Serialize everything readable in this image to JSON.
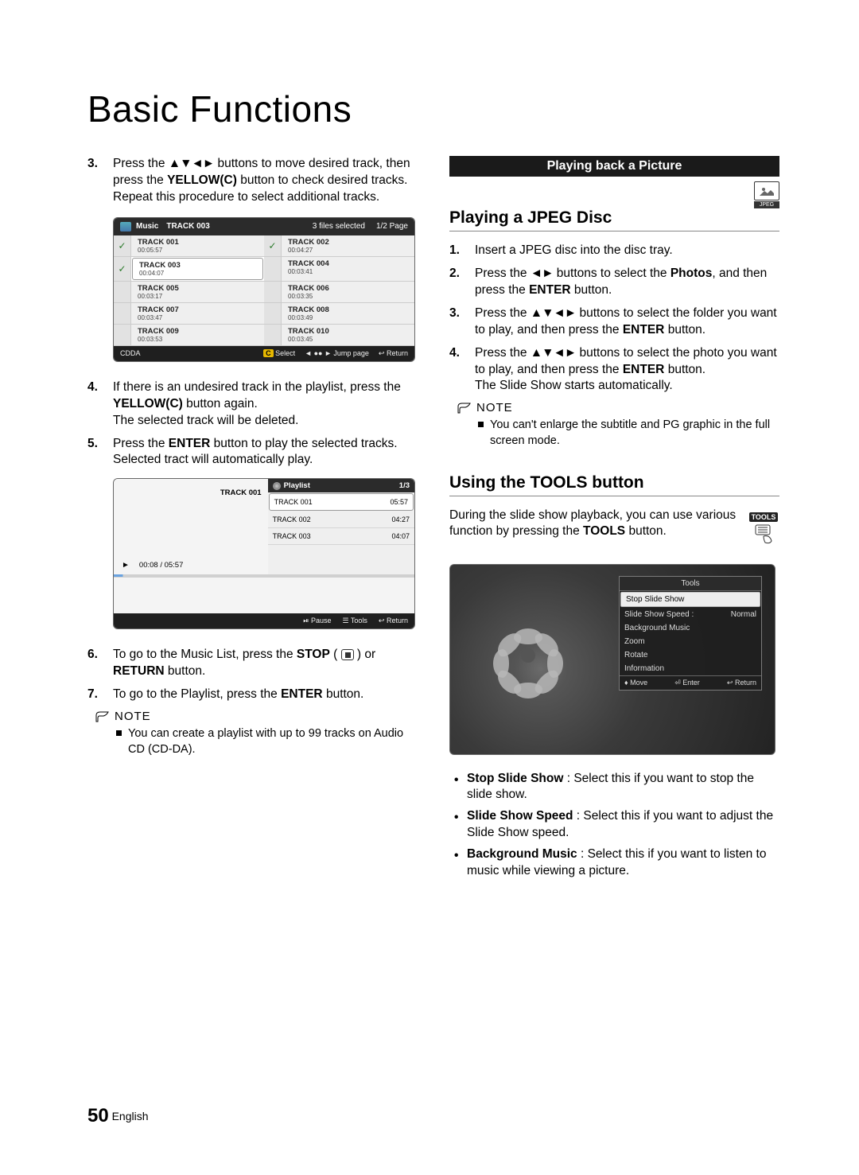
{
  "page_title": "Basic Functions",
  "footer": {
    "page": "50",
    "lang": "English"
  },
  "left": {
    "step3": {
      "num": "3.",
      "text_a": "Press the ",
      "arrows": "▲▼◄►",
      "text_b": " buttons to move desired track, then press the ",
      "yellow": "YELLOW(C)",
      "text_c": " button to check desired tracks.",
      "repeat": "Repeat this procedure to select additional tracks."
    },
    "music_panel": {
      "header_label": "Music",
      "current_track": "TRACK 003",
      "files_selected": "3 files selected",
      "page_indicator": "1/2 Page",
      "tracks": [
        {
          "name": "TRACK 001",
          "dur": "00:05:57",
          "checked": true,
          "sel": false
        },
        {
          "name": "TRACK 002",
          "dur": "00:04:27",
          "checked": true,
          "sel": false
        },
        {
          "name": "TRACK 003",
          "dur": "00:04:07",
          "checked": true,
          "sel": true
        },
        {
          "name": "TRACK 004",
          "dur": "00:03:41",
          "checked": false,
          "sel": false
        },
        {
          "name": "TRACK 005",
          "dur": "00:03:17",
          "checked": false,
          "sel": false
        },
        {
          "name": "TRACK 006",
          "dur": "00:03:35",
          "checked": false,
          "sel": false
        },
        {
          "name": "TRACK 007",
          "dur": "00:03:47",
          "checked": false,
          "sel": false
        },
        {
          "name": "TRACK 008",
          "dur": "00:03:49",
          "checked": false,
          "sel": false
        },
        {
          "name": "TRACK 009",
          "dur": "00:03:53",
          "checked": false,
          "sel": false
        },
        {
          "name": "TRACK 010",
          "dur": "00:03:45",
          "checked": false,
          "sel": false
        }
      ],
      "footer": {
        "left": "CDDA",
        "select_key": "C",
        "select_label": "Select",
        "jump_icon": "◄ ●● ►",
        "jump_label": "Jump page",
        "return_icon": "↩",
        "return_label": "Return"
      }
    },
    "step4": {
      "num": "4.",
      "text_a": "If there is an undesired track in the playlist, press the ",
      "yellow": "YELLOW(C)",
      "text_b": " button again.",
      "after": "The selected track will be deleted."
    },
    "step5": {
      "num": "5.",
      "text_a": "Press the ",
      "enter": "ENTER",
      "text_b": " button to play the selected tracks.",
      "after": "Selected tract will automatically play."
    },
    "playlist_panel": {
      "now_playing": "TRACK 001",
      "elapsed": "00:08 / 05:57",
      "header": "Playlist",
      "page": "1/3",
      "rows": [
        {
          "name": "TRACK 001",
          "dur": "05:57",
          "sel": true
        },
        {
          "name": "TRACK 002",
          "dur": "04:27",
          "sel": false
        },
        {
          "name": "TRACK 003",
          "dur": "04:07",
          "sel": false
        }
      ],
      "footer": {
        "pause_icon": "⏯",
        "pause": "Pause",
        "tools_icon": "☰",
        "tools": "Tools",
        "return_icon": "↩",
        "return": "Return"
      }
    },
    "step6": {
      "num": "6.",
      "text_a": "To go to the Music List, press the ",
      "stop": "STOP",
      "text_b": " ( ",
      "text_c": " ) or ",
      "return": "RETURN",
      "text_d": " button."
    },
    "step7": {
      "num": "7.",
      "text_a": "To go to the Playlist, press the ",
      "enter": "ENTER",
      "text_b": " button."
    },
    "note_label": "NOTE",
    "note1": "You can create a playlist with up to 99 tracks on Audio CD (CD-DA)."
  },
  "right": {
    "section_bar": "Playing back a Picture",
    "jpeg_badge": "JPEG",
    "h_jpeg": "Playing a JPEG Disc",
    "r1": {
      "num": "1.",
      "text": "Insert a JPEG disc into the disc tray."
    },
    "r2": {
      "num": "2.",
      "a": "Press the ",
      "arr": "◄►",
      "b": " buttons to select the ",
      "photos": "Photos",
      "c": ", and then press the ",
      "enter": "ENTER",
      "d": " button."
    },
    "r3": {
      "num": "3.",
      "a": "Press the ",
      "arr": "▲▼◄►",
      "b": " buttons to select the folder you want to play, and then press the ",
      "enter": "ENTER",
      "c": " button."
    },
    "r4": {
      "num": "4.",
      "a": "Press the ",
      "arr": "▲▼◄►",
      "b": " buttons to select the photo you want to play, and then press the ",
      "enter": "ENTER",
      "c": " button.",
      "after": "The Slide Show starts automatically."
    },
    "note_label": "NOTE",
    "note_jpeg": "You can't enlarge the subtitle and PG graphic in the full screen mode.",
    "h_tools": "Using the TOOLS button",
    "tools_para_a": "During the slide show playback, you can use various function by pressing the ",
    "tools_bold": "TOOLS",
    "tools_para_b": " button.",
    "tools_badge": "TOOLS",
    "tools_menu": {
      "title": "Tools",
      "items": [
        {
          "label": "Stop Slide Show",
          "sel": true
        },
        {
          "label": "Slide Show Speed :",
          "right": "Normal"
        },
        {
          "label": "Background Music"
        },
        {
          "label": "Zoom"
        },
        {
          "label": "Rotate"
        },
        {
          "label": "Information"
        }
      ],
      "footer": {
        "move": "♦ Move",
        "enter": "⏎ Enter",
        "return": "↩ Return"
      }
    },
    "bullets": [
      {
        "b": "Stop Slide Show",
        "t": " : Select this if you want to stop the slide show."
      },
      {
        "b": "Slide Show Speed",
        "t": " : Select this if you want to adjust the Slide Show speed."
      },
      {
        "b": "Background Music",
        "t": " : Select this if you want to listen to music while viewing a picture."
      }
    ]
  }
}
